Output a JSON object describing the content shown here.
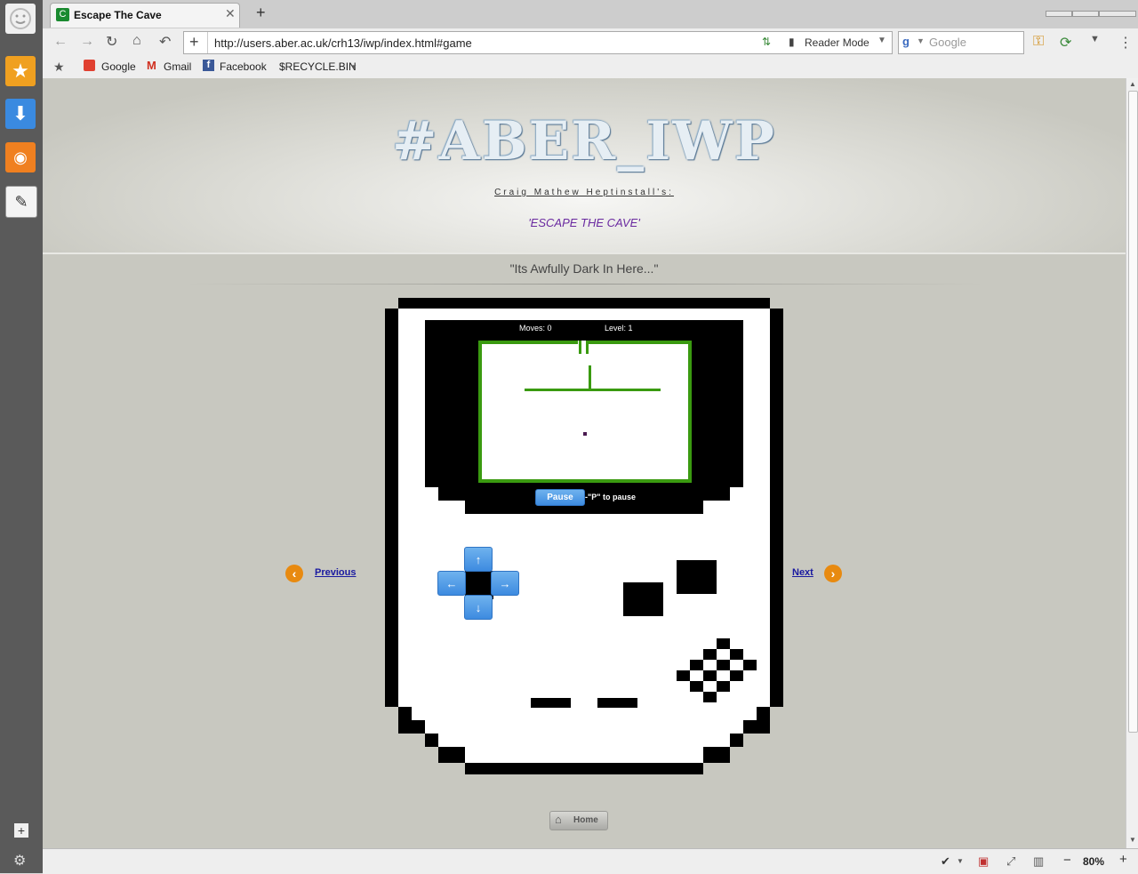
{
  "tab": {
    "title": "Escape The Cave",
    "favicon_letter": "C"
  },
  "toolbar": {
    "url": "http://users.aber.ac.uk/crh13/iwp/index.html#game",
    "reader_mode": "Reader Mode",
    "search_placeholder": "Google"
  },
  "bookmarks": [
    {
      "label": "Google"
    },
    {
      "label": "Gmail"
    },
    {
      "label": "Facebook"
    },
    {
      "label": "$RECYCLE.BIN"
    }
  ],
  "page": {
    "banner": "#ABER_IWP",
    "author": "Craig Mathew Heptinstall's:",
    "game_title": "'ESCAPE THE CAVE'",
    "tagline": "\"Its Awfully Dark In Here...\"",
    "previous": "Previous",
    "next": "Next",
    "home": "Home"
  },
  "game": {
    "moves_label": "Moves: 0",
    "level_label": "Level: 1",
    "pause_label": "Pause",
    "pause_hint": "-\"P\" to pause",
    "dpad": {
      "up": "↑",
      "down": "↓",
      "left": "←",
      "right": "→"
    }
  },
  "status": {
    "zoom": "80%"
  },
  "colors": {
    "wall": "#3a9a10",
    "accent": "#e07a10",
    "link": "#1a1aa0",
    "title_purple": "#6a2aa0"
  }
}
